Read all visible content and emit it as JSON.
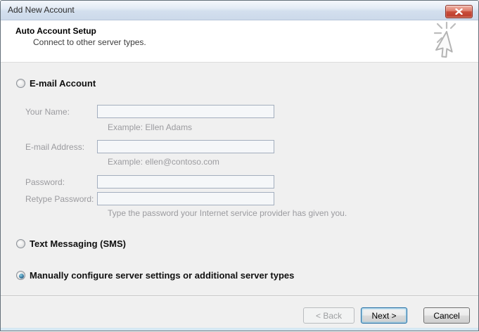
{
  "window": {
    "title": "Add New Account"
  },
  "icons": {
    "close": "window-close-x",
    "decoration": "mouse-click-pointer-with-starburst"
  },
  "header": {
    "title": "Auto Account Setup",
    "subtitle": "Connect to other server types."
  },
  "options": [
    {
      "label": "E-mail Account",
      "selected": false
    },
    {
      "label": "Text Messaging (SMS)",
      "selected": false
    },
    {
      "label": "Manually configure server settings or additional server types",
      "selected": true
    }
  ],
  "form": {
    "disabled": true,
    "fields": [
      {
        "label": "Your Name:",
        "value": "",
        "hint": "Example: Ellen Adams"
      },
      {
        "label": "E-mail Address:",
        "value": "",
        "hint": "Example: ellen@contoso.com"
      },
      {
        "label": "Password:",
        "value": ""
      },
      {
        "label": "Retype Password:",
        "value": "",
        "hint": "Type the password your Internet service provider has given you."
      }
    ]
  },
  "footer": {
    "back": "< Back",
    "next": "Next >",
    "cancel": "Cancel"
  },
  "colors": {
    "titlebar_top": "#f4f7fb",
    "titlebar_bottom": "#ccd9ea",
    "close_red": "#bf4030",
    "header_bg": "#ffffff",
    "body_bg": "#f0f0f0",
    "input_border": "#a3aebe",
    "disabled_text": "#9b9b9f",
    "focus_ring_blue": "#2a70a3",
    "radio_dot_blue": "#173a5e",
    "bottom_strip_blue": "#d5e7f2"
  }
}
